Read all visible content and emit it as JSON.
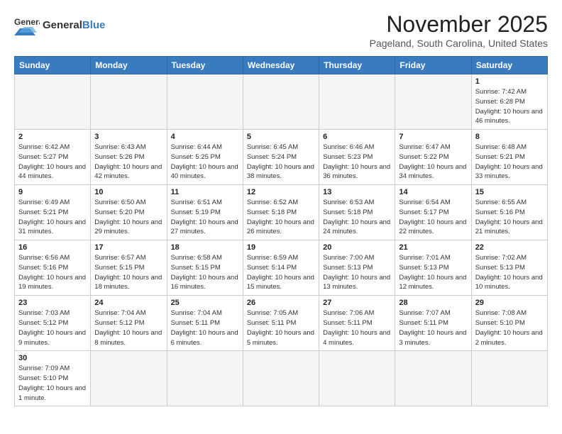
{
  "logo": {
    "text_general": "General",
    "text_blue": "Blue"
  },
  "header": {
    "month": "November 2025",
    "location": "Pageland, South Carolina, United States"
  },
  "weekdays": [
    "Sunday",
    "Monday",
    "Tuesday",
    "Wednesday",
    "Thursday",
    "Friday",
    "Saturday"
  ],
  "weeks": [
    [
      {
        "day": "",
        "info": ""
      },
      {
        "day": "",
        "info": ""
      },
      {
        "day": "",
        "info": ""
      },
      {
        "day": "",
        "info": ""
      },
      {
        "day": "",
        "info": ""
      },
      {
        "day": "",
        "info": ""
      },
      {
        "day": "1",
        "info": "Sunrise: 7:42 AM\nSunset: 6:28 PM\nDaylight: 10 hours and 46 minutes."
      }
    ],
    [
      {
        "day": "2",
        "info": "Sunrise: 6:42 AM\nSunset: 5:27 PM\nDaylight: 10 hours and 44 minutes."
      },
      {
        "day": "3",
        "info": "Sunrise: 6:43 AM\nSunset: 5:26 PM\nDaylight: 10 hours and 42 minutes."
      },
      {
        "day": "4",
        "info": "Sunrise: 6:44 AM\nSunset: 5:25 PM\nDaylight: 10 hours and 40 minutes."
      },
      {
        "day": "5",
        "info": "Sunrise: 6:45 AM\nSunset: 5:24 PM\nDaylight: 10 hours and 38 minutes."
      },
      {
        "day": "6",
        "info": "Sunrise: 6:46 AM\nSunset: 5:23 PM\nDaylight: 10 hours and 36 minutes."
      },
      {
        "day": "7",
        "info": "Sunrise: 6:47 AM\nSunset: 5:22 PM\nDaylight: 10 hours and 34 minutes."
      },
      {
        "day": "8",
        "info": "Sunrise: 6:48 AM\nSunset: 5:21 PM\nDaylight: 10 hours and 33 minutes."
      }
    ],
    [
      {
        "day": "9",
        "info": "Sunrise: 6:49 AM\nSunset: 5:21 PM\nDaylight: 10 hours and 31 minutes."
      },
      {
        "day": "10",
        "info": "Sunrise: 6:50 AM\nSunset: 5:20 PM\nDaylight: 10 hours and 29 minutes."
      },
      {
        "day": "11",
        "info": "Sunrise: 6:51 AM\nSunset: 5:19 PM\nDaylight: 10 hours and 27 minutes."
      },
      {
        "day": "12",
        "info": "Sunrise: 6:52 AM\nSunset: 5:18 PM\nDaylight: 10 hours and 26 minutes."
      },
      {
        "day": "13",
        "info": "Sunrise: 6:53 AM\nSunset: 5:18 PM\nDaylight: 10 hours and 24 minutes."
      },
      {
        "day": "14",
        "info": "Sunrise: 6:54 AM\nSunset: 5:17 PM\nDaylight: 10 hours and 22 minutes."
      },
      {
        "day": "15",
        "info": "Sunrise: 6:55 AM\nSunset: 5:16 PM\nDaylight: 10 hours and 21 minutes."
      }
    ],
    [
      {
        "day": "16",
        "info": "Sunrise: 6:56 AM\nSunset: 5:16 PM\nDaylight: 10 hours and 19 minutes."
      },
      {
        "day": "17",
        "info": "Sunrise: 6:57 AM\nSunset: 5:15 PM\nDaylight: 10 hours and 18 minutes."
      },
      {
        "day": "18",
        "info": "Sunrise: 6:58 AM\nSunset: 5:15 PM\nDaylight: 10 hours and 16 minutes."
      },
      {
        "day": "19",
        "info": "Sunrise: 6:59 AM\nSunset: 5:14 PM\nDaylight: 10 hours and 15 minutes."
      },
      {
        "day": "20",
        "info": "Sunrise: 7:00 AM\nSunset: 5:13 PM\nDaylight: 10 hours and 13 minutes."
      },
      {
        "day": "21",
        "info": "Sunrise: 7:01 AM\nSunset: 5:13 PM\nDaylight: 10 hours and 12 minutes."
      },
      {
        "day": "22",
        "info": "Sunrise: 7:02 AM\nSunset: 5:13 PM\nDaylight: 10 hours and 10 minutes."
      }
    ],
    [
      {
        "day": "23",
        "info": "Sunrise: 7:03 AM\nSunset: 5:12 PM\nDaylight: 10 hours and 9 minutes."
      },
      {
        "day": "24",
        "info": "Sunrise: 7:04 AM\nSunset: 5:12 PM\nDaylight: 10 hours and 8 minutes."
      },
      {
        "day": "25",
        "info": "Sunrise: 7:04 AM\nSunset: 5:11 PM\nDaylight: 10 hours and 6 minutes."
      },
      {
        "day": "26",
        "info": "Sunrise: 7:05 AM\nSunset: 5:11 PM\nDaylight: 10 hours and 5 minutes."
      },
      {
        "day": "27",
        "info": "Sunrise: 7:06 AM\nSunset: 5:11 PM\nDaylight: 10 hours and 4 minutes."
      },
      {
        "day": "28",
        "info": "Sunrise: 7:07 AM\nSunset: 5:11 PM\nDaylight: 10 hours and 3 minutes."
      },
      {
        "day": "29",
        "info": "Sunrise: 7:08 AM\nSunset: 5:10 PM\nDaylight: 10 hours and 2 minutes."
      }
    ],
    [
      {
        "day": "30",
        "info": "Sunrise: 7:09 AM\nSunset: 5:10 PM\nDaylight: 10 hours and 1 minute."
      },
      {
        "day": "",
        "info": ""
      },
      {
        "day": "",
        "info": ""
      },
      {
        "day": "",
        "info": ""
      },
      {
        "day": "",
        "info": ""
      },
      {
        "day": "",
        "info": ""
      },
      {
        "day": "",
        "info": ""
      }
    ]
  ]
}
